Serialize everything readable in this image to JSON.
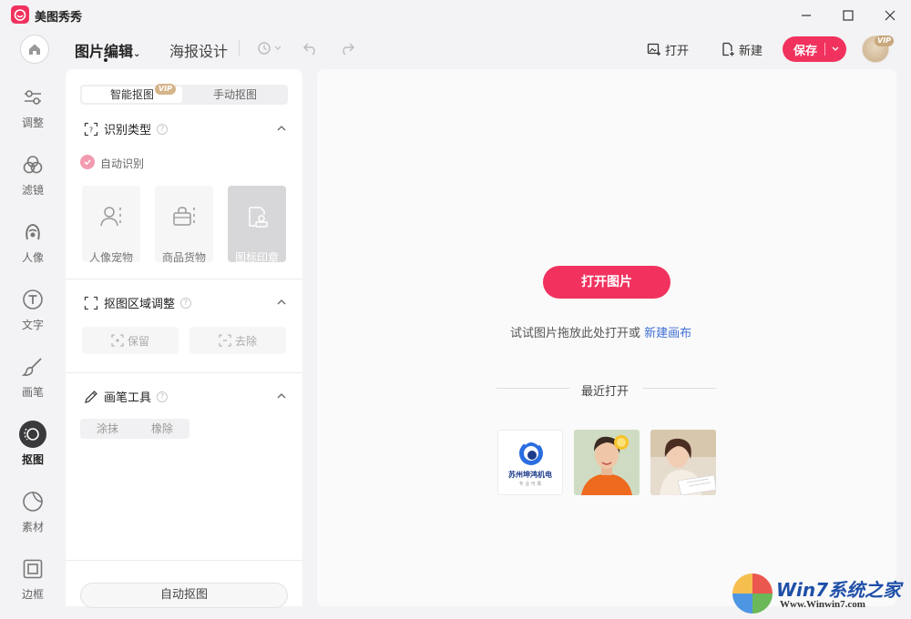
{
  "app": {
    "title": "美图秀秀",
    "brand_color": "#f1325e"
  },
  "window": {
    "minimize_icon": "minimize-icon",
    "maximize_icon": "maximize-icon",
    "close_icon": "close-icon"
  },
  "toolbar": {
    "nav_edit": "图片编辑",
    "nav_poster": "海报设计",
    "open_label": "打开",
    "new_label": "新建",
    "save_label": "保存",
    "vip_label": "VIP"
  },
  "rail": {
    "items": [
      {
        "label": "调整",
        "icon": "sliders-icon"
      },
      {
        "label": "滤镜",
        "icon": "filter-icon"
      },
      {
        "label": "人像",
        "icon": "portrait-icon"
      },
      {
        "label": "文字",
        "icon": "text-icon"
      },
      {
        "label": "画笔",
        "icon": "brush-icon"
      },
      {
        "label": "抠图",
        "icon": "cutout-icon",
        "active": true
      },
      {
        "label": "素材",
        "icon": "sticker-icon"
      },
      {
        "label": "边框",
        "icon": "frame-icon"
      }
    ]
  },
  "panel": {
    "tabs": {
      "smart": "智能抠图",
      "manual": "手动抠图",
      "vip": "VIP"
    },
    "recognize": {
      "title": "识别类型",
      "auto_label": "自动识别",
      "types": [
        {
          "label": "人像宠物"
        },
        {
          "label": "商品货物"
        },
        {
          "label": "图标印章"
        }
      ]
    },
    "region": {
      "title": "抠图区域调整",
      "keep": "保留",
      "remove": "去除"
    },
    "brush": {
      "title": "画笔工具",
      "smear": "涂抹",
      "erase": "橡除"
    },
    "auto_button": "自动抠图"
  },
  "canvas": {
    "open_button": "打开图片",
    "hint": "试试图片拖放此处打开或",
    "hint_link": "新建画布",
    "recent_title": "最近打开",
    "recent": [
      {
        "caption": "苏州坤鸿机电",
        "subcaption": "专 业 可 靠"
      },
      {
        "caption": ""
      },
      {
        "caption": ""
      }
    ]
  },
  "watermark": {
    "title": "Win7系统之家",
    "url": "Www.Winwin7.com"
  }
}
